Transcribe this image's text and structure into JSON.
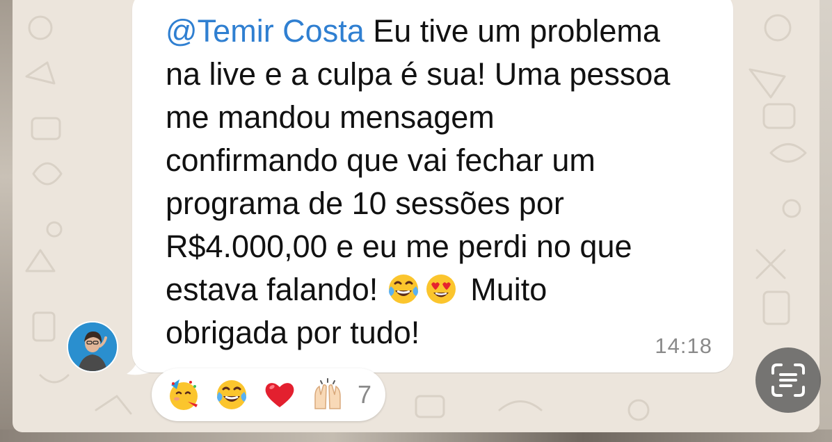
{
  "message": {
    "mention": "@Temir Costa",
    "lines": [
      " Eu tive um problema",
      "na live e a culpa é sua! Uma pessoa",
      "me mandou mensagem",
      "confirmando que vai fechar um",
      "programa de 10 sessões por",
      "R$4.000,00 e eu me perdi no que",
      "estava falando!",
      "Muito",
      "obrigada por tudo!"
    ],
    "inline_emojis": [
      "tears-of-joy-emoji",
      "heart-eyes-emoji"
    ],
    "timestamp": "14:18"
  },
  "reactions": {
    "emojis": [
      "partying-face-emoji",
      "tears-of-joy-emoji",
      "red-heart-emoji",
      "raising-hands-emoji"
    ],
    "count": "7"
  },
  "controls": {
    "live_text_icon": "live-text-scan-icon"
  },
  "colors": {
    "mention": "#2f7fd1",
    "bubble": "#ffffff",
    "wallpaper": "#ece5dc",
    "timestamp": "#8a8a8a"
  }
}
